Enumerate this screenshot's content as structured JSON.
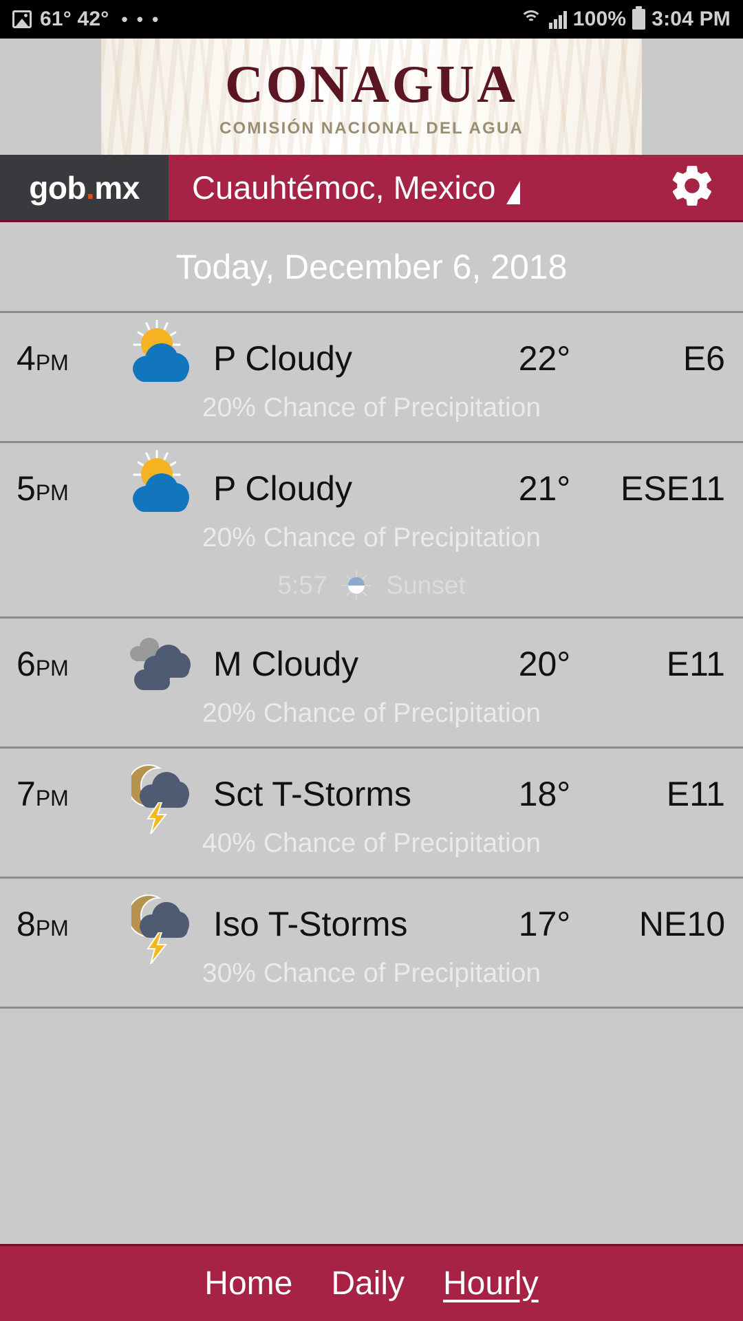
{
  "status_bar": {
    "image_icon": "image-icon",
    "temps": "61° 42°",
    "overflow": "• • •",
    "wifi_icon": "wifi-icon",
    "signal_icon": "signal-icon",
    "battery_percent": "100%",
    "battery_icon": "battery-icon",
    "clock": "3:04 PM"
  },
  "banner": {
    "title": "CONAGUA",
    "subtitle": "COMISIÓN NACIONAL DEL AGUA"
  },
  "navbar": {
    "brand": "gob",
    "brand_dot": ".",
    "brand_suffix": "mx",
    "location": "Cuauhtémoc, Mexico",
    "caret_icon": "dropdown-caret-icon",
    "settings_icon": "gear-icon",
    "brand_bg": "#383a3e",
    "accent": "#a62346"
  },
  "date_header": {
    "label": "Today, December 6, 2018"
  },
  "hourly": [
    {
      "hour": "4",
      "meridiem": "PM",
      "icon": "partly-cloudy-day-icon",
      "condition": "P Cloudy",
      "temp": "22°",
      "wind": "E6",
      "precip": "20% Chance of Precipitation",
      "event": null
    },
    {
      "hour": "5",
      "meridiem": "PM",
      "icon": "partly-cloudy-day-icon",
      "condition": "P Cloudy",
      "temp": "21°",
      "wind": "ESE11",
      "precip": "20% Chance of Precipitation",
      "event": {
        "time": "5:57",
        "icon": "sunset-icon",
        "label": "Sunset"
      }
    },
    {
      "hour": "6",
      "meridiem": "PM",
      "icon": "mostly-cloudy-icon",
      "condition": "M Cloudy",
      "temp": "20°",
      "wind": "E11",
      "precip": "20% Chance of Precipitation",
      "event": null
    },
    {
      "hour": "7",
      "meridiem": "PM",
      "icon": "thunderstorm-night-icon",
      "condition": "Sct T-Storms",
      "temp": "18°",
      "wind": "E11",
      "precip": "40% Chance of Precipitation",
      "event": null
    },
    {
      "hour": "8",
      "meridiem": "PM",
      "icon": "thunderstorm-night-icon",
      "condition": "Iso T-Storms",
      "temp": "17°",
      "wind": "NE10",
      "precip": "30% Chance of Precipitation",
      "event": null
    }
  ],
  "bottom_nav": {
    "items": [
      {
        "label": "Home",
        "active": false
      },
      {
        "label": "Daily",
        "active": false
      },
      {
        "label": "Hourly",
        "active": true
      }
    ]
  }
}
